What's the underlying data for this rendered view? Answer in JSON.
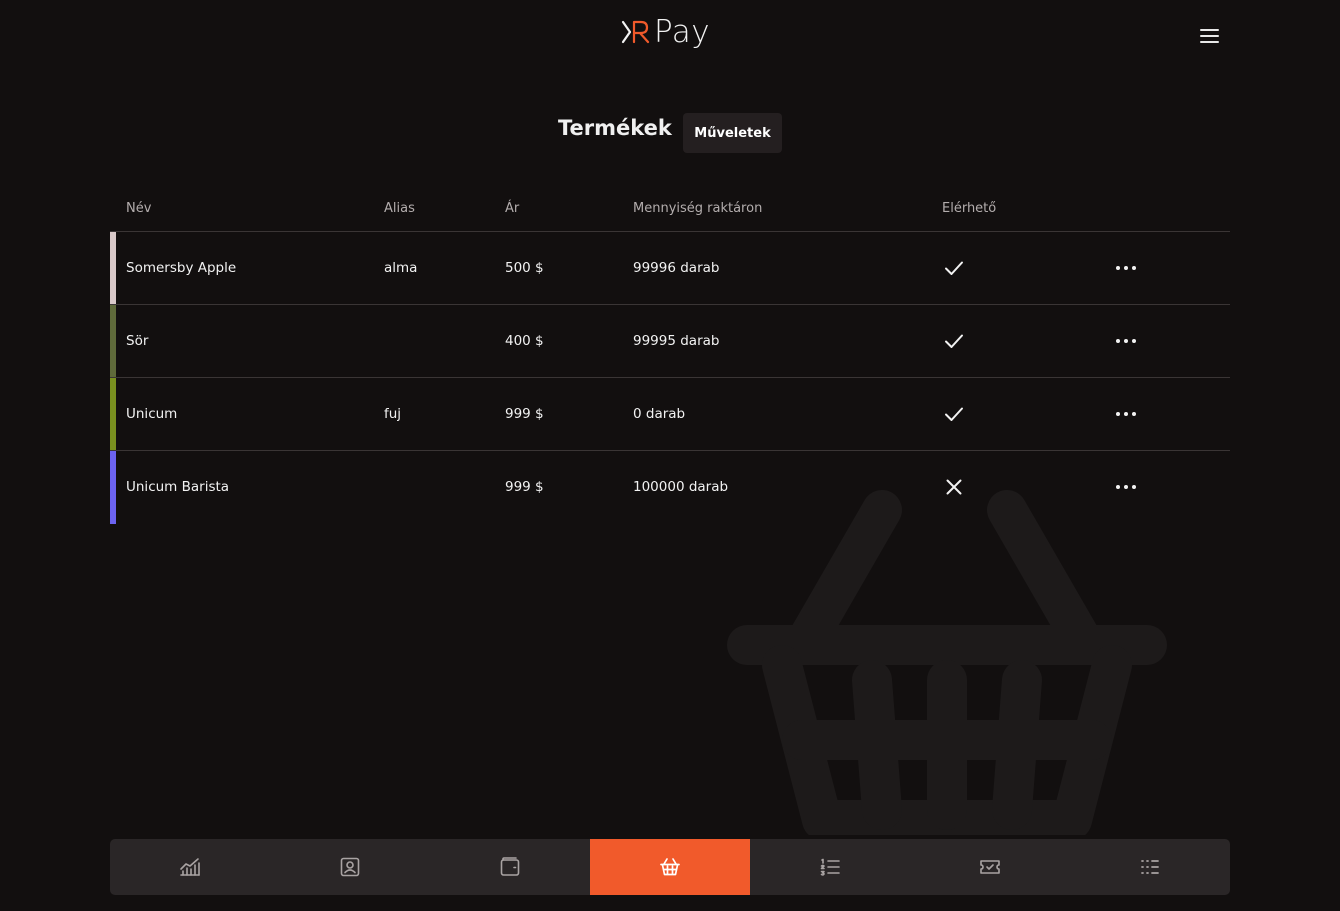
{
  "app": {
    "logo_text": "Pay",
    "brand_color": "#f15a2b"
  },
  "header": {
    "menu_icon": "hamburger-icon"
  },
  "page": {
    "title": "Termékek",
    "actions_label": "Műveletek"
  },
  "table": {
    "columns": [
      "Név",
      "Alias",
      "Ár",
      "Mennyiség raktáron",
      "Elérhető"
    ],
    "rows": [
      {
        "name": "Somersby Apple",
        "alias": "alma",
        "price": "500 $",
        "quantity": "99996 darab",
        "available": true,
        "color": "#d9c9c9"
      },
      {
        "name": "Sör",
        "alias": "",
        "price": "400 $",
        "quantity": "99995 darab",
        "available": true,
        "color": "#5f6a3a"
      },
      {
        "name": "Unicum",
        "alias": "fuj",
        "price": "999 $",
        "quantity": "0 darab",
        "available": true,
        "color": "#79901f"
      },
      {
        "name": "Unicum Barista",
        "alias": "",
        "price": "999 $",
        "quantity": "100000 darab",
        "available": false,
        "color": "#6c63f0"
      }
    ]
  },
  "bottom_nav": {
    "items": [
      {
        "icon": "chart-icon",
        "active": false
      },
      {
        "icon": "user-card-icon",
        "active": false
      },
      {
        "icon": "wallet-icon",
        "active": false
      },
      {
        "icon": "basket-icon",
        "active": true
      },
      {
        "icon": "numbered-list-icon",
        "active": false
      },
      {
        "icon": "ticket-icon",
        "active": false
      },
      {
        "icon": "list-icon",
        "active": false
      }
    ]
  }
}
